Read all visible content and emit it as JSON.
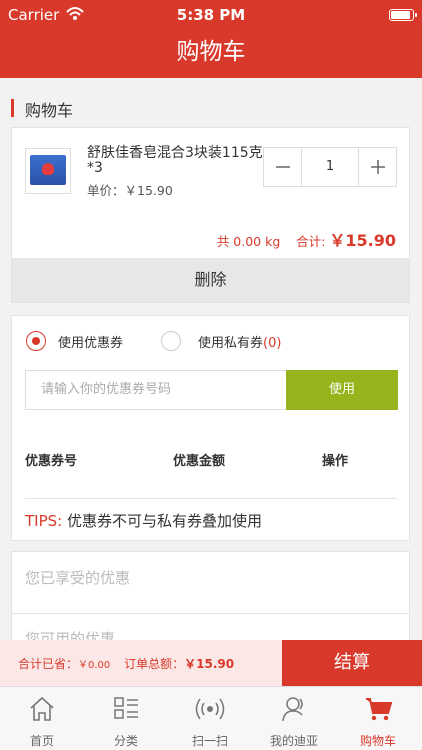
{
  "status_bar": {
    "carrier": "Carrier",
    "time": "5:38 PM"
  },
  "nav": {
    "title": "购物车"
  },
  "cart": {
    "section_title": "购物车",
    "item": {
      "name": "舒肤佳香皂混合3块装115克*3",
      "unit_price": "单价：￥15.90",
      "quantity": "1",
      "weight": "共 0.00 kg",
      "subtotal_label": "合计:",
      "subtotal": "￥15.90"
    },
    "delete_label": "删除"
  },
  "coupon": {
    "option_coupon": "使用优惠券",
    "option_private": "使用私有券",
    "private_count": "(0)",
    "input_placeholder": "请输入你的优惠券号码",
    "use_label": "使用",
    "columns": [
      "优惠券号",
      "优惠金额",
      "操作"
    ],
    "tips_label": "TIPS:",
    "tips_text": "优惠券不可与私有券叠加使用"
  },
  "discounts": {
    "enjoyed_title": "您已享受的优惠",
    "available_title": "您可用的优惠"
  },
  "checkout": {
    "saved_label": "合计已省：",
    "saved_value": "￥0.00",
    "total_label": "订单总额：",
    "total_value": "￥15.90",
    "checkout_label": "结算"
  },
  "tabbar": {
    "tabs": [
      {
        "label": "首页",
        "icon": "home-icon"
      },
      {
        "label": "分类",
        "icon": "category-icon"
      },
      {
        "label": "扫一扫",
        "icon": "scan-icon"
      },
      {
        "label": "我的迪亚",
        "icon": "user-icon"
      },
      {
        "label": "购物车",
        "icon": "cart-icon",
        "active": true
      }
    ]
  },
  "colors": {
    "brand": "#d9392b",
    "use_button": "#97b41c",
    "checkout_bar_bg": "#fbe8e6"
  }
}
